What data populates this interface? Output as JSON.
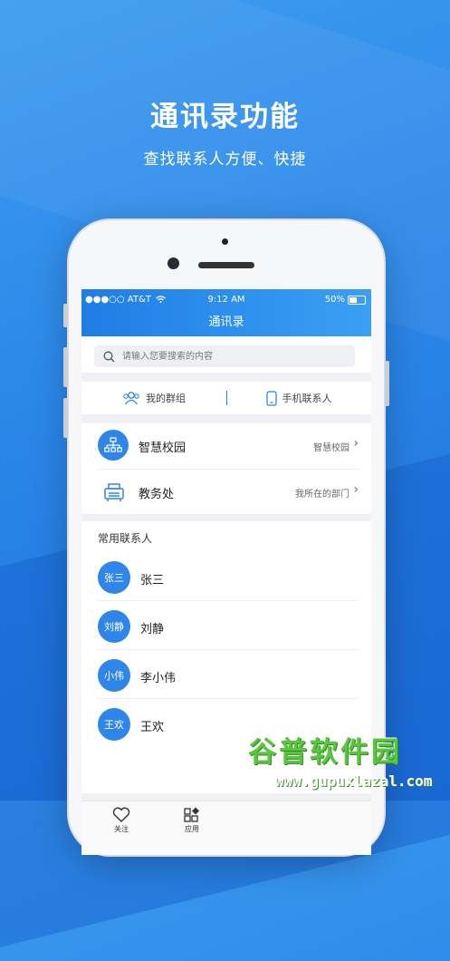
{
  "promo": {
    "title": "通讯录功能",
    "subtitle": "查找联系人方便、快捷"
  },
  "status_bar": {
    "carrier": "●●●○○ AT&T",
    "time": "9:12 AM",
    "battery": "50%",
    "battery_level": 0.5
  },
  "nav": {
    "title": "通讯录"
  },
  "search": {
    "placeholder": "请输入您要搜索的内容"
  },
  "tabs": [
    {
      "label": "我的群组",
      "icon": "group-icon"
    },
    {
      "label": "手机联系人",
      "icon": "phone-icon"
    }
  ],
  "org": [
    {
      "name": "智慧校园",
      "meta": "智慧校园",
      "icon": "org-chart-icon"
    },
    {
      "name": "教务处",
      "meta": "我所在的部门",
      "icon": "department-icon"
    }
  ],
  "contacts": {
    "title": "常用联系人",
    "items": [
      {
        "avatar": "张三",
        "name": "张三"
      },
      {
        "avatar": "刘静",
        "name": "刘静"
      },
      {
        "avatar": "小伟",
        "name": "李小伟"
      },
      {
        "avatar": "王欢",
        "name": "王欢"
      }
    ]
  },
  "bottom_nav": [
    {
      "label": "关注",
      "icon": "heart-icon"
    },
    {
      "label": "应用",
      "icon": "apps-icon"
    }
  ],
  "watermark": {
    "brand": "谷普软件园",
    "url": "www.gupuxlazal.com"
  },
  "colors": {
    "primary": "#2e86e9",
    "background": "#2b86e8",
    "watermark_green": "#59c73e"
  }
}
